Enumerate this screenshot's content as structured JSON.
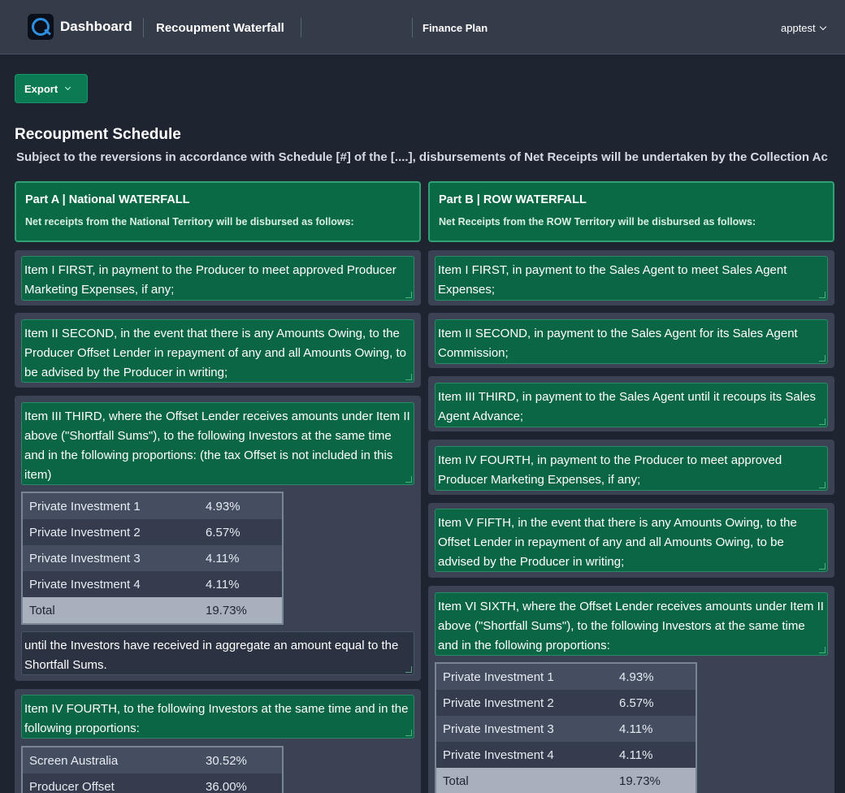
{
  "nav": {
    "brand": "Dashboard",
    "link1": "Recoupment Waterfall",
    "link2": "Finance Plan",
    "user": "apptest"
  },
  "export_label": "Export",
  "schedule": {
    "title": "Recoupment Schedule",
    "subtitle": "Subject to the reversions in accordance with Schedule [#] of the [....], disbursements of Net Receipts will be undertaken by the Collection Ac"
  },
  "partA": {
    "title": "Part A | National WATERFALL",
    "subtitle": "Net receipts from the National Territory will be disbursed as follows:",
    "item1": "Item I FIRST, in payment to the Producer to meet approved Producer Marketing Expenses, if any;",
    "item2": "Item II SECOND, in the event that there is any Amounts Owing, to the Producer Offset Lender in repayment of any and all Amounts Owing, to be advised by the Producer in writing;",
    "item3": "Item III THIRD, where the Offset Lender receives amounts under Item II above (\"Shortfall Sums\"), to the following Investors at the same time and in the following proportions: (the tax Offset is not included in this item)",
    "item3_table": [
      {
        "name": "Private Investment 1",
        "value": "4.93%"
      },
      {
        "name": "Private Investment 2",
        "value": "6.57%"
      },
      {
        "name": "Private Investment 3",
        "value": "4.11%"
      },
      {
        "name": "Private Investment 4",
        "value": "4.11%"
      },
      {
        "name": "Total",
        "value": "19.73%"
      }
    ],
    "item3_after": "until the Investors have received in aggregate an amount equal to the Shortfall Sums.",
    "item4": "Item IV FOURTH, to the following Investors at the same time and in the following proportions:",
    "item4_table": [
      {
        "name": "Screen Australia",
        "value": "30.52%"
      },
      {
        "name": "Producer Offset",
        "value": "36.00%"
      }
    ]
  },
  "partB": {
    "title": "Part B | ROW WATERFALL",
    "subtitle": "Net Receipts from the ROW Territory will be disbursed as follows:",
    "item1": "Item I FIRST, in payment to the Sales Agent to meet Sales Agent Expenses;",
    "item2": "Item II SECOND, in payment to the Sales Agent for its Sales Agent Commission;",
    "item3": "Item III THIRD, in payment to the Sales Agent until it recoups its Sales Agent Advance;",
    "item4": "Item IV FOURTH, in payment to the Producer to meet approved Producer Marketing Expenses, if any;",
    "item5": "Item V FIFTH, in the event that there is any Amounts Owing, to the Offset Lender in repayment of any and all Amounts Owing, to be advised by the Producer in writing;",
    "item6": "Item VI SIXTH, where the Offset Lender receives amounts under Item II above (\"Shortfall Sums\"), to the following Investors at the same time and in the following proportions:",
    "item6_table": [
      {
        "name": "Private Investment 1",
        "value": "4.93%"
      },
      {
        "name": "Private Investment 2",
        "value": "6.57%"
      },
      {
        "name": "Private Investment 3",
        "value": "4.11%"
      },
      {
        "name": "Private Investment 4",
        "value": "4.11%"
      },
      {
        "name": "Total",
        "value": "19.73%"
      }
    ]
  }
}
